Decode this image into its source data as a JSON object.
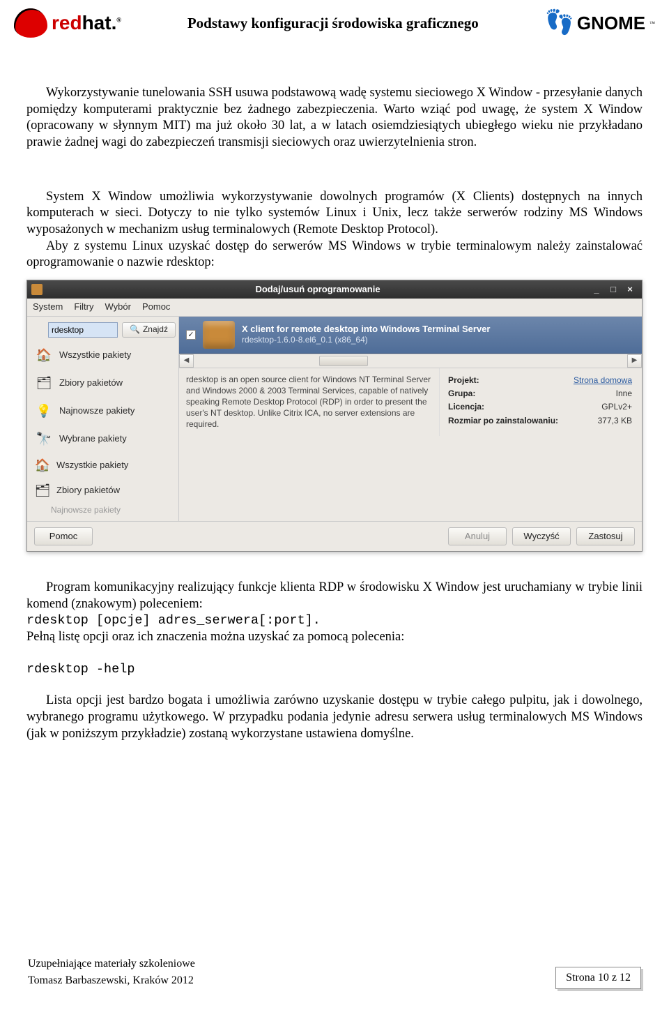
{
  "header": {
    "title": "Podstawy konfiguracji środowiska graficznego",
    "redhat_red": "red",
    "redhat_black": "hat.",
    "gnome": "GNOME"
  },
  "body": {
    "p1": "Wykorzystywanie tunelowania SSH usuwa podstawową wadę systemu sieciowego X Window - przesyłanie danych pomiędzy komputerami praktycznie bez żadnego zabezpieczenia. Warto wziąć pod uwagę, że system X Window (opracowany w słynnym MIT) ma już około 30 lat, a w latach osiemdziesiątych ubiegłego wieku nie przykładano prawie żadnej wagi do zabezpieczeń transmisji sieciowych oraz uwierzytelnienia stron.",
    "p2a": "System X Window umożliwia wykorzystywanie dowolnych programów (X Clients) dostępnych na innych komputerach w sieci. Dotyczy to nie tylko systemów Linux i Unix, lecz także serwerów rodziny MS Windows wyposażonych w mechanizm usług terminalowych (Remote Desktop Protocol).",
    "p2b": "Aby z systemu Linux uzyskać dostęp do serwerów MS Windows w trybie terminalowym należy zainstalować oprogramowanie o nazwie rdesktop:",
    "p3a": "Program komunikacyjny realizujący funkcje klienta RDP w środowisku X Window jest uruchamiany w trybie linii komend (znakowym) poleceniem:",
    "cmd1": "rdesktop [opcje] adres_serwera[:port].",
    "p3b": "Pełną listę opcji oraz ich znaczenia można uzyskać za pomocą polecenia:",
    "cmd2": "rdesktop -help",
    "p4": "Lista opcji jest bardzo bogata i umożliwia zarówno uzyskanie dostępu w trybie całego pulpitu, jak i dowolnego, wybranego programu użytkowego. W przypadku podania jedynie adresu serwera usług terminalowych MS Windows (jak w poniższym przykładzie) zostaną wykorzystane ustawiena domyślne."
  },
  "window": {
    "title": "Dodaj/usuń oprogramowanie",
    "menubar": [
      "System",
      "Filtry",
      "Wybór",
      "Pomoc"
    ],
    "search_value": "rdesktop",
    "find_btn": "Znajdź",
    "sidebar_items": [
      {
        "icon": "🏠",
        "label": "Wszystkie pakiety"
      },
      {
        "icon": "🗂",
        "label": "Zbiory pakietów"
      },
      {
        "icon": "💡",
        "label": "Najnowsze pakiety"
      },
      {
        "icon": "🔭",
        "label": "Wybrane pakiety"
      },
      {
        "icon": "🏠",
        "label": "Wszystkie pakiety"
      },
      {
        "icon": "🗂",
        "label": "Zbiory pakietów"
      }
    ],
    "sidebar_cut": "Najnowsze pakiety",
    "result": {
      "title": "X client for remote desktop into Windows Terminal Server",
      "sub": "rdesktop-1.6.0-8.el6_0.1 (x86_64)"
    },
    "description": "rdesktop is an open source client for Windows NT Terminal Server and Windows 2000 & 2003 Terminal Services, capable of natively speaking Remote Desktop Protocol (RDP) in order to present the user's NT desktop. Unlike Citrix ICA, no server extensions are required.",
    "meta": {
      "project_k": "Projekt:",
      "project_v": "Strona domowa",
      "group_k": "Grupa:",
      "group_v": "Inne",
      "license_k": "Licencja:",
      "license_v": "GPLv2+",
      "size_k": "Rozmiar po zainstalowaniu:",
      "size_v": "377,3 KB"
    },
    "actions": {
      "help": "Pomoc",
      "cancel": "Anuluj",
      "clear": "Wyczyść",
      "apply": "Zastosuj"
    }
  },
  "footer": {
    "line1": "Uzupełniające materiały szkoleniowe",
    "line2": "Tomasz Barbaszewski, Kraków 2012",
    "page": "Strona 10 z 12"
  }
}
